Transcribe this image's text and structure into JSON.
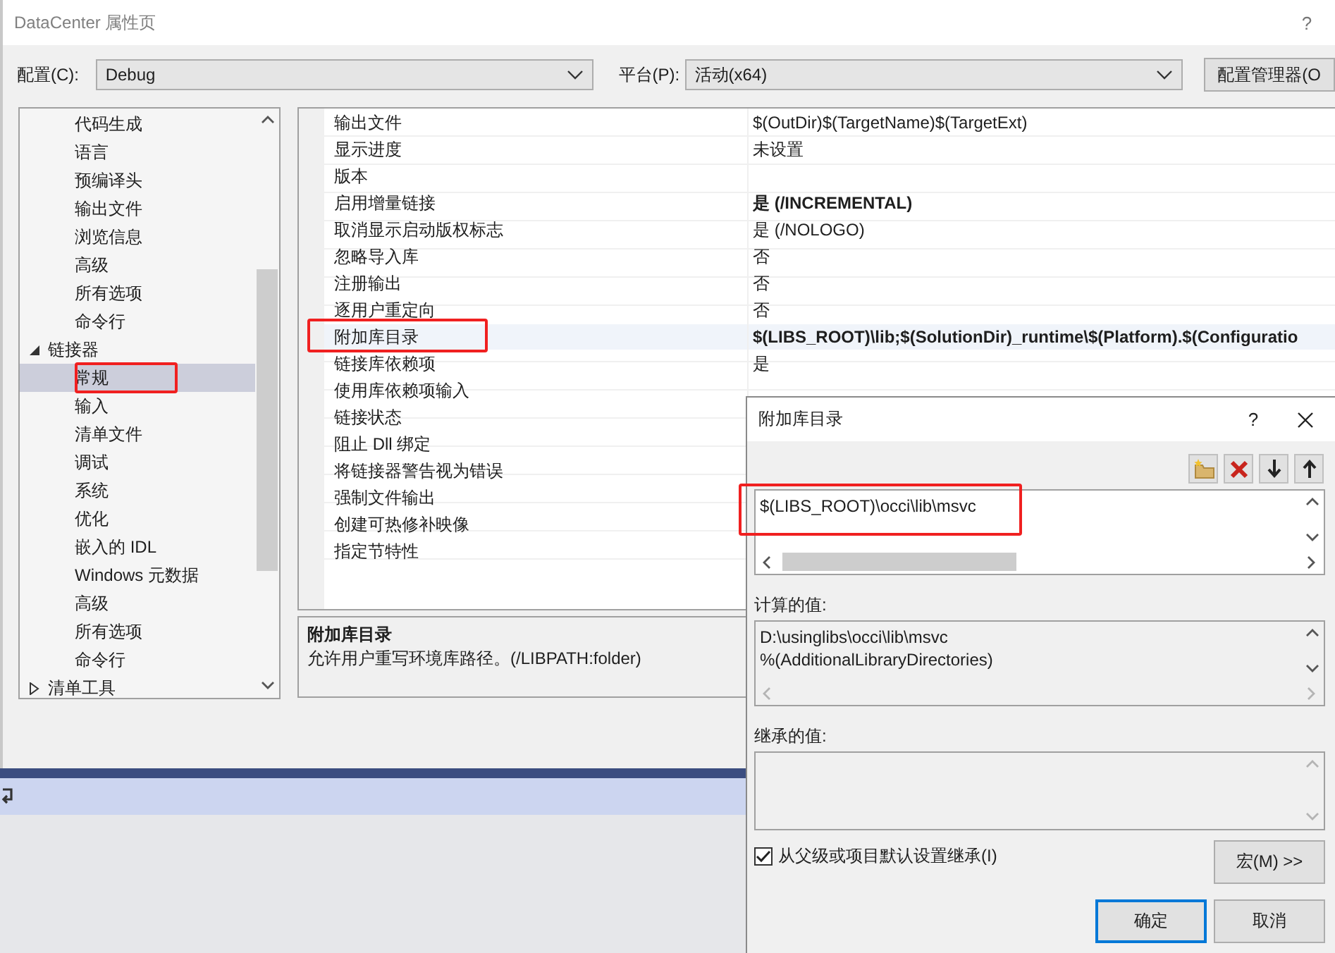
{
  "window": {
    "title": "DataCenter 属性页",
    "help": "?"
  },
  "configuration": {
    "label": "配置(C):",
    "value": "Debug"
  },
  "platform": {
    "label": "平台(P):",
    "value": "活动(x64)"
  },
  "config_manager_button": "配置管理器(O",
  "tree": {
    "items": [
      {
        "children": [
          {
            "label": "代码生成",
            "selected": false,
            "highlighted": false
          },
          {
            "label": "语言",
            "selected": false,
            "highlighted": false
          },
          {
            "label": "预编译头",
            "selected": false,
            "highlighted": false
          },
          {
            "label": "输出文件",
            "selected": false,
            "highlighted": false
          },
          {
            "label": "浏览信息",
            "selected": false,
            "highlighted": false
          },
          {
            "label": "高级",
            "selected": false,
            "highlighted": false
          },
          {
            "label": "所有选项",
            "selected": false,
            "highlighted": false
          },
          {
            "label": "命令行",
            "selected": false,
            "highlighted": false
          }
        ]
      },
      {
        "label": "链接器",
        "selected": false,
        "highlighted": false,
        "expanded": true,
        "children": [
          {
            "label": "常规",
            "selected": true,
            "highlighted": true
          },
          {
            "label": "输入",
            "selected": false,
            "highlighted": false
          },
          {
            "label": "清单文件",
            "selected": false,
            "highlighted": false
          },
          {
            "label": "调试",
            "selected": false,
            "highlighted": false
          },
          {
            "label": "系统",
            "selected": false,
            "highlighted": false
          },
          {
            "label": "优化",
            "selected": false,
            "highlighted": false
          },
          {
            "label": "嵌入的 IDL",
            "selected": false,
            "highlighted": false
          },
          {
            "label": "Windows 元数据",
            "selected": false,
            "highlighted": false
          },
          {
            "label": "高级",
            "selected": false,
            "highlighted": false
          },
          {
            "label": "所有选项",
            "selected": false,
            "highlighted": false
          },
          {
            "label": "命令行",
            "selected": false,
            "highlighted": false
          }
        ]
      },
      {
        "label": "清单工具",
        "selected": false,
        "highlighted": false,
        "expanded": false
      }
    ]
  },
  "properties": [
    {
      "label": "输出文件",
      "value": "$(OutDir)$(TargetName)$(TargetExt)",
      "bold": false,
      "selected": false,
      "highlighted": false
    },
    {
      "label": "显示进度",
      "value": "未设置",
      "bold": false,
      "selected": false,
      "highlighted": false
    },
    {
      "label": "版本",
      "selected": false,
      "highlighted": false
    },
    {
      "label": "启用增量链接",
      "value": "是 (/INCREMENTAL)",
      "bold": true,
      "selected": false,
      "highlighted": false
    },
    {
      "label": "取消显示启动版权标志",
      "value": "是 (/NOLOGO)",
      "bold": false,
      "selected": false,
      "highlighted": false
    },
    {
      "label": "忽略导入库",
      "value": "否",
      "bold": false,
      "selected": false,
      "highlighted": false
    },
    {
      "label": "注册输出",
      "value": "否",
      "bold": false,
      "selected": false,
      "highlighted": false
    },
    {
      "label": "逐用户重定向",
      "value": "否",
      "bold": false,
      "selected": false,
      "highlighted": false
    },
    {
      "label": "附加库目录",
      "value": "$(LIBS_ROOT)\\lib;$(SolutionDir)_runtime\\$(Platform).$(Configuratio",
      "bold": true,
      "selected": true,
      "highlighted": true
    },
    {
      "label": "链接库依赖项",
      "value": "是",
      "bold": false,
      "selected": false,
      "highlighted": false
    },
    {
      "label": "使用库依赖项输入",
      "selected": false,
      "highlighted": false
    },
    {
      "label": "链接状态",
      "selected": false,
      "highlighted": false
    },
    {
      "label": "阻止 Dll 绑定",
      "selected": false,
      "highlighted": false
    },
    {
      "label": "将链接器警告视为错误",
      "selected": false,
      "highlighted": false
    },
    {
      "label": "强制文件输出",
      "selected": false,
      "highlighted": false
    },
    {
      "label": "创建可热修补映像",
      "selected": false,
      "highlighted": false
    },
    {
      "label": "指定节特性",
      "selected": false,
      "highlighted": false
    }
  ],
  "description": {
    "title": "附加库目录",
    "text": "允许用户重写环境库路径。(/LIBPATH:folder)"
  },
  "dialog": {
    "title": "附加库目录",
    "help": "?",
    "entries": [
      {
        "text": "$(LIBS_ROOT)\\occi\\lib\\msvc",
        "highlighted": true
      }
    ],
    "computed_label": "计算的值:",
    "computed_values": [
      "D:\\usinglibs\\occi\\lib\\msvc",
      "%(AdditionalLibraryDirectories)"
    ],
    "inherited_label": "继承的值:",
    "inherit": {
      "label": "从父级或项目默认设置继承(I)",
      "checked": true
    },
    "macro_button": "宏(M) >>",
    "ok_button": "确定",
    "cancel_button": "取消"
  }
}
